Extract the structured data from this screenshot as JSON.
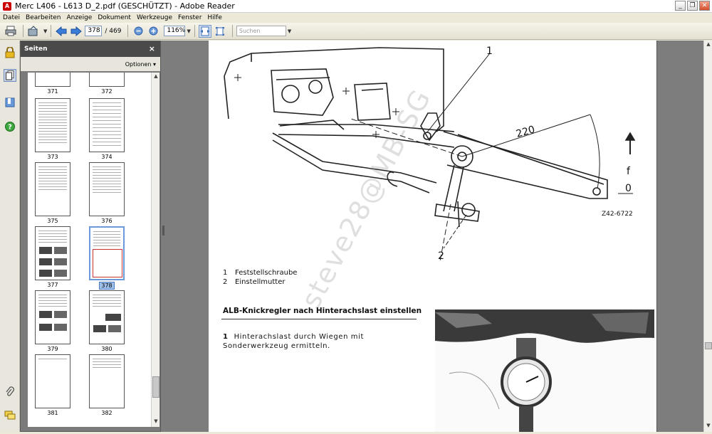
{
  "window": {
    "title": "Merc L406 - L613 D_2.pdf (GESCHÜTZT) - Adobe Reader",
    "minimize": "_",
    "restore": "❐",
    "close": "✕"
  },
  "menu": [
    "Datei",
    "Bearbeiten",
    "Anzeige",
    "Dokument",
    "Werkzeuge",
    "Fenster",
    "Hilfe"
  ],
  "toolbar": {
    "page_current": "378",
    "page_total": "/ 469",
    "zoom": "116%",
    "search_placeholder": "Suchen"
  },
  "sidebar": {
    "title": "Seiten",
    "close": "×",
    "options": "Optionen ▾",
    "thumbnails": [
      {
        "label": "371"
      },
      {
        "label": "372"
      },
      {
        "label": "373"
      },
      {
        "label": "374"
      },
      {
        "label": "375"
      },
      {
        "label": "376"
      },
      {
        "label": "377"
      },
      {
        "label": "378",
        "selected": true
      },
      {
        "label": "379"
      },
      {
        "label": "380"
      },
      {
        "label": "381"
      },
      {
        "label": "382"
      }
    ]
  },
  "document": {
    "drawing_labels": {
      "callout_1": "1",
      "callout_2": "2",
      "dimension": "220",
      "arrow_f": "f",
      "arrow_0": "0",
      "figure_id": "Z42-6722"
    },
    "legend": [
      {
        "num": "1",
        "text": "Feststellschraube"
      },
      {
        "num": "2",
        "text": "Einstellmutter"
      }
    ],
    "heading": "ALB-Knickregler nach Hinterachslast einstellen",
    "step": {
      "num": "1",
      "text": "Hinterachslast durch Wiegen mit Sonderwerkzeug ermitteln."
    },
    "watermark": "steve28@MB-SG"
  }
}
